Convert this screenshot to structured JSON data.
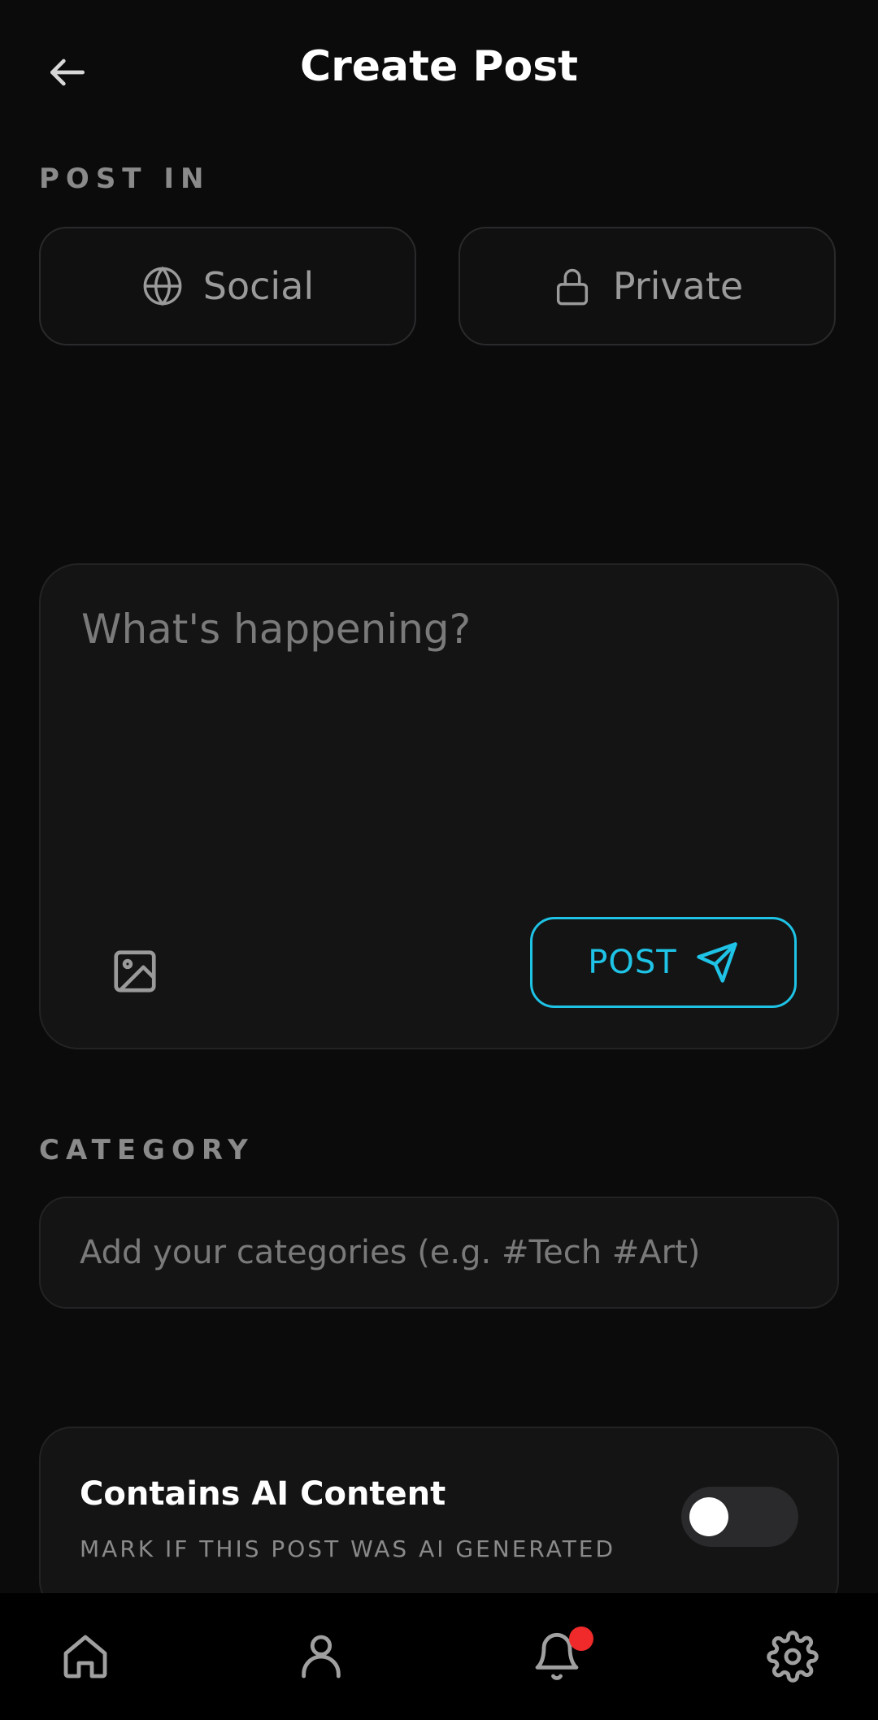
{
  "header": {
    "title": "Create Post",
    "back_icon": "arrow-left-icon"
  },
  "post_in": {
    "label": "POST IN",
    "options": [
      {
        "label": "Social",
        "icon": "globe-icon"
      },
      {
        "label": "Private",
        "icon": "lock-icon"
      }
    ]
  },
  "composer": {
    "placeholder": "What's happening?",
    "value": "",
    "image_icon": "image-icon",
    "post_label": "POST",
    "post_icon": "send-icon"
  },
  "category": {
    "label": "CATEGORY",
    "placeholder": "Add your categories (e.g. #Tech #Art)",
    "value": ""
  },
  "ai_content": {
    "title": "Contains AI Content",
    "subtitle": "MARK IF THIS POST WAS AI GENERATED",
    "enabled": false
  },
  "bottom_nav": {
    "items": [
      {
        "name": "home",
        "icon": "home-icon"
      },
      {
        "name": "profile",
        "icon": "user-icon"
      },
      {
        "name": "notifications",
        "icon": "bell-icon",
        "has_badge": true
      },
      {
        "name": "settings",
        "icon": "gear-icon"
      }
    ]
  },
  "colors": {
    "accent": "#1ec3e6",
    "background": "#0b0b0c",
    "badge": "#f02a2a"
  }
}
